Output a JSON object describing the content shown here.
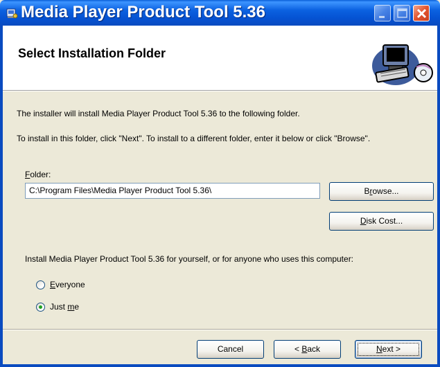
{
  "window": {
    "title": "Media Player Product Tool 5.36",
    "controls": [
      "minimize",
      "maximize",
      "close"
    ]
  },
  "banner": {
    "title": "Select Installation Folder",
    "graphic_icon": "computer-with-cd-icon"
  },
  "body": {
    "intro": "The installer will install Media Player Product Tool 5.36 to the following folder.",
    "instructions": "To install in this folder, click \"Next\". To install to a different folder, enter it below or click \"Browse\"."
  },
  "folder": {
    "label_accesskey": "F",
    "label_rest": "older:",
    "value": "C:\\Program Files\\Media Player Product Tool 5.36\\"
  },
  "buttons": {
    "browse_pre": "B",
    "browse_key": "r",
    "browse_post": "owse...",
    "disk_cost_key": "D",
    "disk_cost_post": "isk Cost...",
    "cancel": "Cancel",
    "back_pre": "< ",
    "back_key": "B",
    "back_post": "ack",
    "next_key": "N",
    "next_post": "ext >"
  },
  "install_for": {
    "prompt": "Install Media Player Product Tool 5.36 for yourself, or for anyone who uses this computer:",
    "options": [
      {
        "key": "E",
        "rest": "veryone",
        "selected": false
      },
      {
        "pre": "Just ",
        "key": "m",
        "rest": "e",
        "selected": true
      }
    ]
  },
  "colors": {
    "titlebar": "#0553D3",
    "dialog_bg": "#ECE9D8",
    "radio_dot": "#21A121"
  }
}
